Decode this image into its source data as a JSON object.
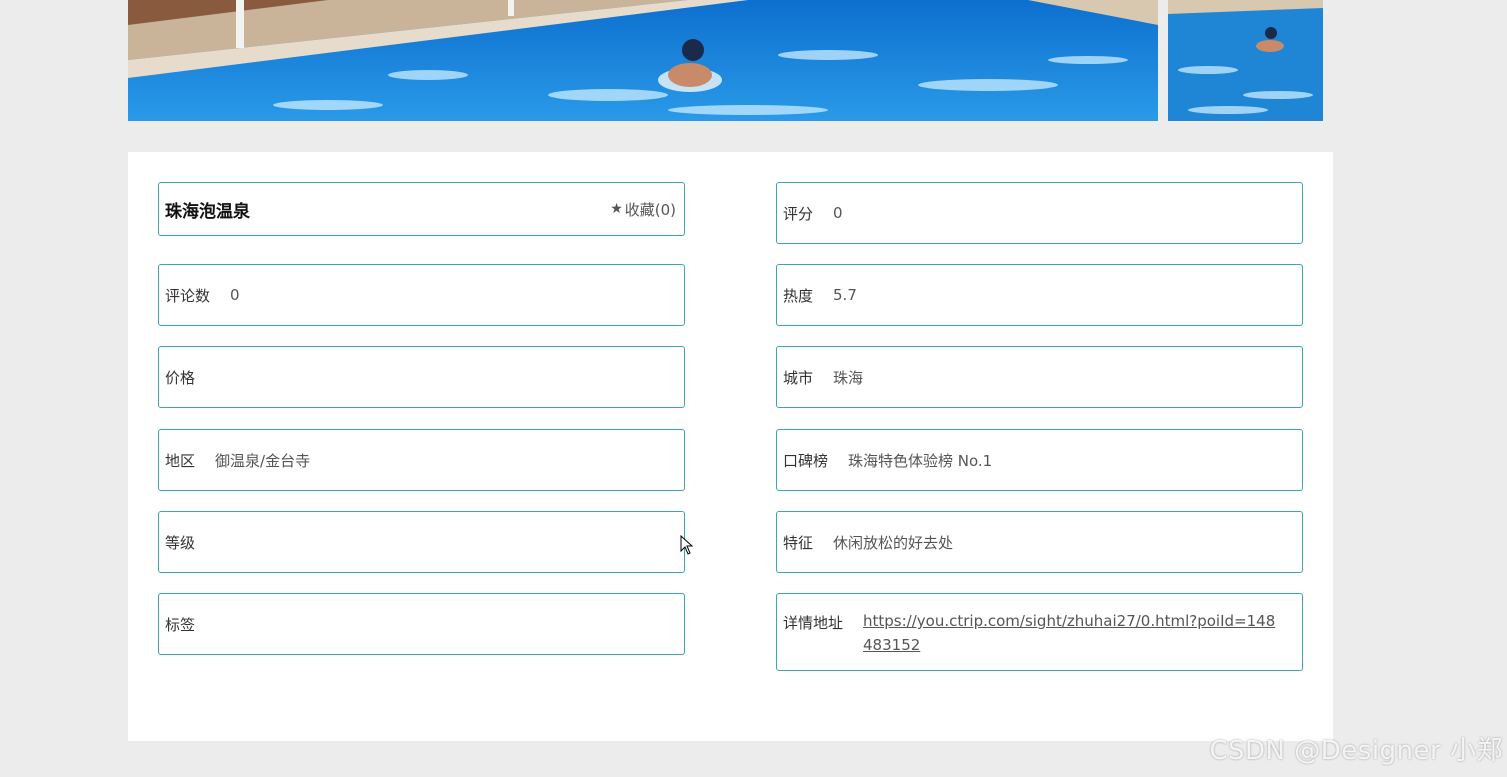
{
  "gallery": {
    "main_alt": "pool-photo",
    "thumb_alt": "pool-photo-thumbnail"
  },
  "attraction": {
    "title": "珠海泡温泉",
    "favorite_label": "收藏(0)"
  },
  "fields_left": [
    {
      "label": "评论数",
      "value": "0"
    },
    {
      "label": "价格",
      "value": ""
    },
    {
      "label": "地区",
      "value": "御温泉/金台寺"
    },
    {
      "label": "等级",
      "value": ""
    },
    {
      "label": "标签",
      "value": ""
    }
  ],
  "fields_right": [
    {
      "label": "评分",
      "value": "0"
    },
    {
      "label": "热度",
      "value": "5.7"
    },
    {
      "label": "城市",
      "value": "珠海"
    },
    {
      "label": "口碑榜",
      "value": "珠海特色体验榜 No.1"
    },
    {
      "label": "特征",
      "value": "休闲放松的好去处"
    },
    {
      "label": "详情地址",
      "value": "https://you.ctrip.com/sight/zhuhai27/0.html?poiId=148483152"
    }
  ],
  "watermark": "CSDN @Designer 小郑",
  "icons": {
    "favorite": "star-icon",
    "cursor": "mouse-cursor-icon"
  },
  "colors": {
    "border": "#3aa6b0",
    "page_bg": "#ececec",
    "pool_water": "#1e88d8"
  }
}
